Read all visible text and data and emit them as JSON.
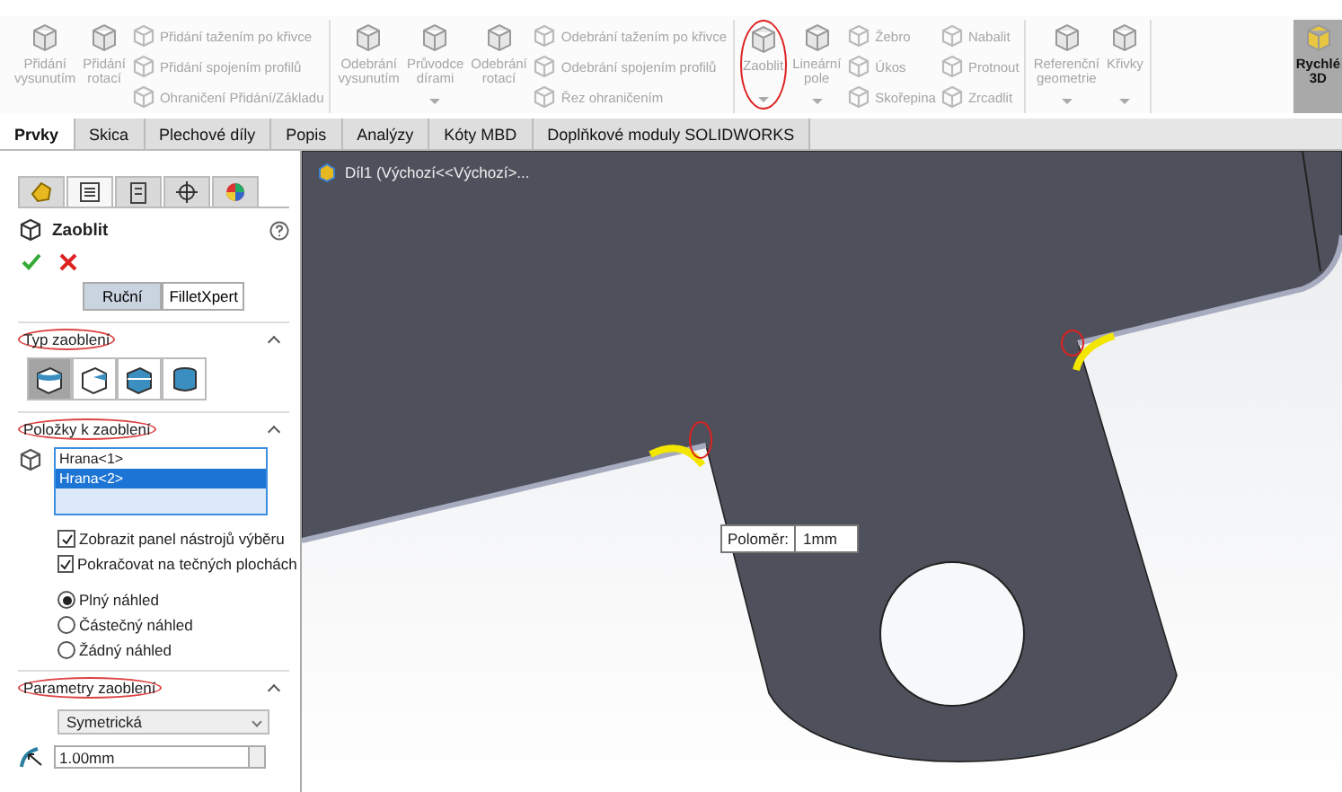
{
  "ribbon": {
    "groups": [
      {
        "large": [
          {
            "label": "Přidání vysunutím",
            "disabled": true,
            "dropdown": false,
            "highlighted": false
          },
          {
            "label": "Přidání rotací",
            "disabled": true,
            "dropdown": false,
            "highlighted": false
          }
        ],
        "small_columns": [
          [
            {
              "label": "Přidání tažením po křivce",
              "disabled": true
            },
            {
              "label": "Přidání spojením profilů",
              "disabled": true
            },
            {
              "label": "Ohraničení Přidání/Základu",
              "disabled": true
            }
          ]
        ]
      },
      {
        "large": [
          {
            "label": "Odebrání vysunutím",
            "disabled": true,
            "dropdown": false,
            "highlighted": false
          },
          {
            "label": "Průvodce dírami",
            "disabled": true,
            "dropdown": true,
            "highlighted": false
          },
          {
            "label": "Odebrání rotací",
            "disabled": true,
            "dropdown": false,
            "highlighted": false
          }
        ],
        "small_columns": [
          [
            {
              "label": "Odebrání tažením po křivce",
              "disabled": true
            },
            {
              "label": "Odebrání spojením profilů",
              "disabled": true
            },
            {
              "label": "Řez ohraničením",
              "disabled": true
            }
          ]
        ]
      },
      {
        "large": [
          {
            "label": "Zaoblit",
            "disabled": true,
            "dropdown": true,
            "highlighted": true
          },
          {
            "label": "Lineární pole",
            "disabled": true,
            "dropdown": true,
            "highlighted": false
          }
        ],
        "small_columns": [
          [
            {
              "label": "Žebro",
              "disabled": true
            },
            {
              "label": "Úkos",
              "disabled": true
            },
            {
              "label": "Skořepina",
              "disabled": true
            }
          ],
          [
            {
              "label": "Nabalit",
              "disabled": true
            },
            {
              "label": "Protnout",
              "disabled": true
            },
            {
              "label": "Zrcadlit",
              "disabled": true
            }
          ]
        ]
      },
      {
        "large": [
          {
            "label": "Referenční geometrie",
            "disabled": true,
            "dropdown": true,
            "highlighted": false
          },
          {
            "label": "Křivky",
            "disabled": true,
            "dropdown": true,
            "highlighted": false
          }
        ]
      },
      {
        "large": [
          {
            "label": "Rychlé 3D",
            "disabled": false,
            "dropdown": false,
            "highlighted": false
          }
        ]
      }
    ]
  },
  "command_tabs": [
    {
      "label": "Prvky",
      "selected": true
    },
    {
      "label": "Skica",
      "selected": false
    },
    {
      "label": "Plechové díly",
      "selected": false
    },
    {
      "label": "Popis",
      "selected": false
    },
    {
      "label": "Analýzy",
      "selected": false
    },
    {
      "label": "Kóty MBD",
      "selected": false
    },
    {
      "label": "Doplňkové moduly SOLIDWORKS",
      "selected": false
    }
  ],
  "property_manager": {
    "tabs": [
      {
        "selected": false
      },
      {
        "selected": true
      },
      {
        "selected": false
      },
      {
        "selected": false
      },
      {
        "selected": false
      }
    ],
    "title": "Zaoblit",
    "mode_toggle": [
      {
        "label": "Ruční",
        "selected": true
      },
      {
        "label": "FilletXpert",
        "selected": false
      }
    ],
    "sections": [
      {
        "kind": "fillet_type",
        "title": "Typ zaoblení",
        "highlighted": true,
        "expanded": true,
        "options": [
          {
            "selected": true
          },
          {
            "selected": false
          },
          {
            "selected": false
          },
          {
            "selected": false
          }
        ]
      },
      {
        "kind": "items",
        "title": "Položky k zaoblení",
        "highlighted": true,
        "expanded": true,
        "edges": [
          {
            "label": "Hrana<1>",
            "selected": false
          },
          {
            "label": "Hrana<2>",
            "selected": true
          }
        ],
        "checkboxes": [
          {
            "label": "Zobrazit panel nástrojů výběru",
            "checked": true
          },
          {
            "label": "Pokračovat na tečných plochách",
            "checked": true
          }
        ],
        "radios": [
          {
            "label": "Plný náhled",
            "selected": true
          },
          {
            "label": "Částečný náhled",
            "selected": false
          },
          {
            "label": "Žádný náhled",
            "selected": false
          }
        ]
      },
      {
        "kind": "parameters",
        "title": "Parametry zaoblení",
        "highlighted": true,
        "expanded": true,
        "method": "Symetrická",
        "radius": "1.00mm"
      }
    ]
  },
  "viewport": {
    "tree_label": "Díl1  (Výchozí<<Výchozí>...",
    "callout": {
      "label": "Poloměr:",
      "value": "1mm"
    }
  }
}
